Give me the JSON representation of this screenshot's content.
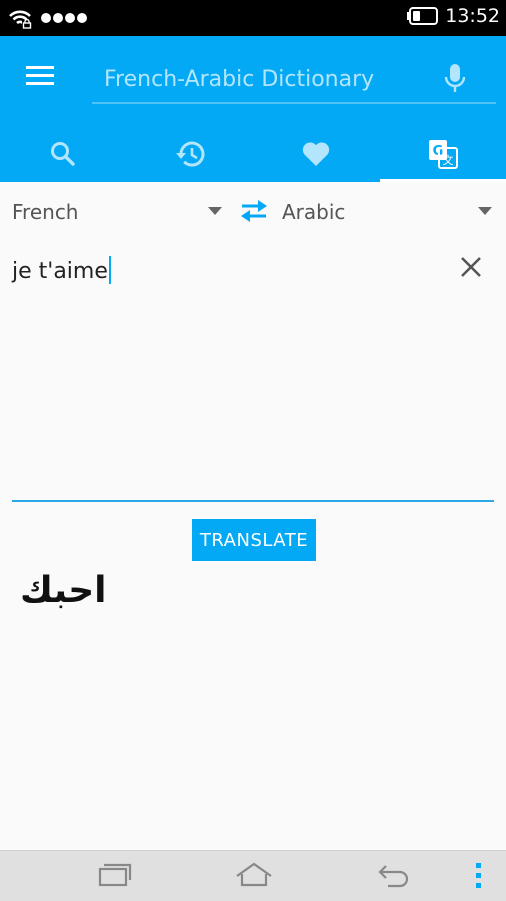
{
  "status_bar": {
    "time": "13:52"
  },
  "header": {
    "search_placeholder": "French-Arabic Dictionary",
    "tabs": [
      {
        "icon": "search-icon"
      },
      {
        "icon": "history-icon"
      },
      {
        "icon": "heart-icon"
      },
      {
        "icon": "translate-icon",
        "active": true
      }
    ]
  },
  "translator": {
    "source_language": "French",
    "target_language": "Arabic",
    "input_text": "je t'aime",
    "translate_label": "TRANSLATE",
    "result_text": "احبك"
  },
  "colors": {
    "accent": "#03a9f4",
    "background": "#fafafa",
    "nav_bar": "#e0e0e0"
  }
}
